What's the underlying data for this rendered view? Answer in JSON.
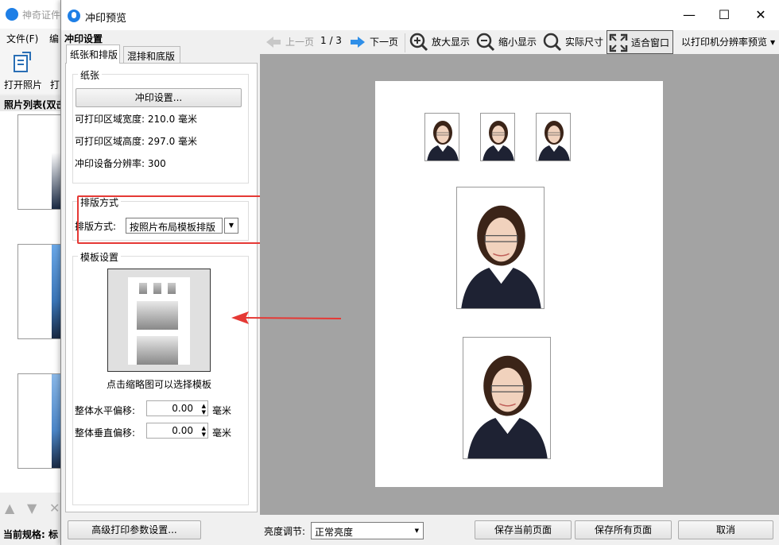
{
  "background_app": {
    "title": "神奇证件",
    "menu": [
      "文件(F)",
      "编"
    ],
    "toolbar": {
      "open_photo": "打开照片",
      "second": "打"
    },
    "list_header": "照片列表(双击",
    "status": "当前规格: 标"
  },
  "dialog": {
    "title": "冲印预览",
    "window_controls": {
      "minimize": "—",
      "maximize": "☐",
      "close": "✕"
    },
    "left_panel": {
      "header": "冲印设置",
      "tabs": [
        "纸张和排版",
        "混排和底版"
      ],
      "paper_group": {
        "title": "纸张",
        "print_settings_button": "冲印设置...",
        "width_line": "可打印区域宽度: 210.0 毫米",
        "height_line": "可打印区域高度: 297.0 毫米",
        "dpi_line": "冲印设备分辨率: 300"
      },
      "layout_group": {
        "title": "排版方式",
        "label": "排版方式:",
        "selected": "按照片布局模板排版"
      },
      "template_group": {
        "title": "模板设置",
        "hint": "点击缩略图可以选择模板",
        "h_offset_label": "整体水平偏移:",
        "h_offset_value": "0.00",
        "v_offset_label": "整体垂直偏移:",
        "v_offset_value": "0.00",
        "unit": "毫米"
      }
    },
    "toolbar": {
      "prev": "上一页",
      "page_indicator": "1 / 3",
      "next": "下一页",
      "zoom_in": "放大显示",
      "zoom_out": "缩小显示",
      "actual_size": "实际尺寸",
      "fit_window": "适合窗口",
      "printer_res": "以打印机分辨率预览"
    },
    "bottom": {
      "advanced_button": "高级打印参数设置...",
      "brightness_label": "亮度调节:",
      "brightness_value": "正常亮度",
      "save_current": "保存当前页面",
      "save_all": "保存所有页面",
      "cancel": "取消"
    }
  },
  "colors": {
    "accent_blue": "#1e7fe6",
    "annotation_red": "#e53935",
    "preview_bg": "#a3a3a3"
  }
}
